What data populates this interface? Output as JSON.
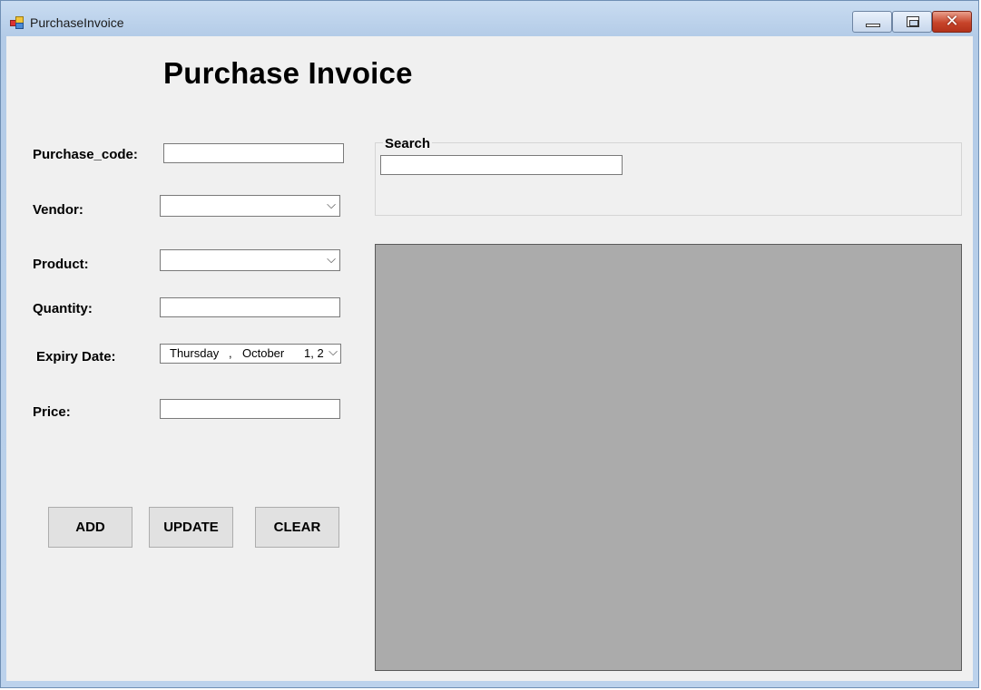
{
  "window": {
    "title": "PurchaseInvoice",
    "controls": {
      "minimize": "minimize",
      "maximize": "maximize",
      "close": "✕"
    }
  },
  "form": {
    "heading": "Purchase Invoice",
    "purchase_code": {
      "label": "Purchase_code:",
      "value": ""
    },
    "vendor": {
      "label": "Vendor:",
      "value": ""
    },
    "product": {
      "label": "Product:",
      "value": ""
    },
    "quantity": {
      "label": "Quantity:",
      "value": ""
    },
    "expiry_date": {
      "label": "Expiry Date:",
      "weekday": "Thursday",
      "sep": ",",
      "month": "October",
      "day": "1, 2"
    },
    "price": {
      "label": "Price:",
      "value": ""
    }
  },
  "buttons": {
    "add": "ADD",
    "update": "UPDATE",
    "clear": "CLEAR"
  },
  "search": {
    "group_label": "Search",
    "value": ""
  },
  "colors": {
    "grid_background": "#ababab",
    "client_background": "#f0f0f0"
  }
}
